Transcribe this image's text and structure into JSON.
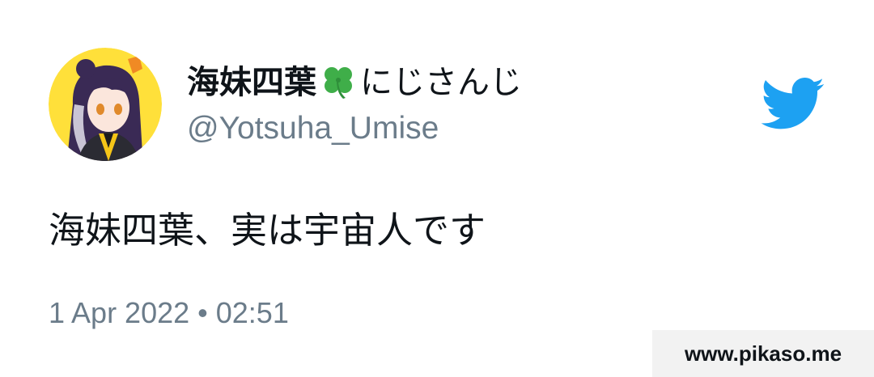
{
  "tweet": {
    "author": {
      "name_part1": "海妹四葉",
      "name_emoji": "four-leaf-clover-emoji",
      "name_part2": "にじさんじ",
      "handle": "@Yotsuha_Umise",
      "avatar": "anime-character-avatar"
    },
    "text": "海妹四葉、実は宇宙人です",
    "timestamp": "1 Apr 2022 • 02:51",
    "platform_icon": "twitter-bird-icon"
  },
  "colors": {
    "twitter_blue": "#1da1f2",
    "handle_gray": "#6b7c8a",
    "text_dark": "#0f1419",
    "avatar_bg": "#ffe03a",
    "clover_green": "#3fae49",
    "watermark_bg": "#f2f2f2"
  },
  "watermark": {
    "text": "www.pikaso.me"
  }
}
